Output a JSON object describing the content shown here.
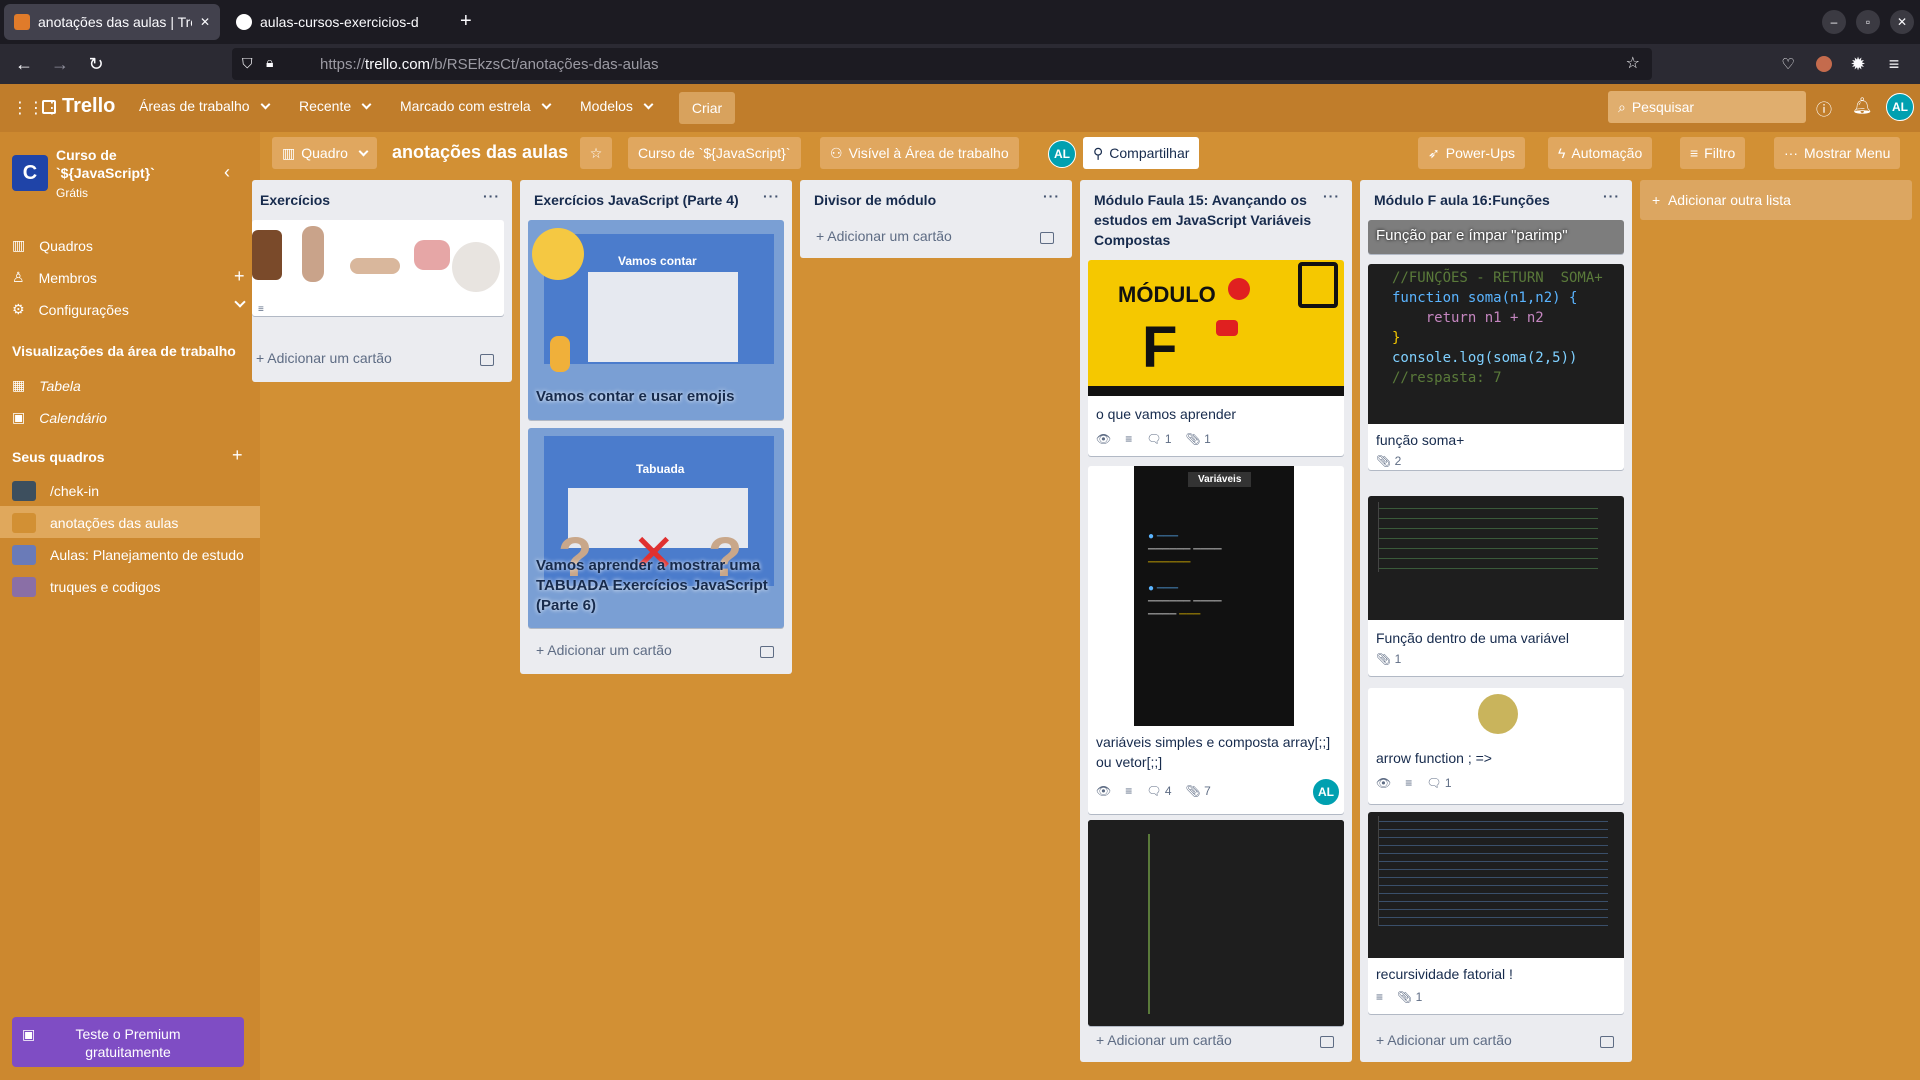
{
  "browser": {
    "tabs": [
      {
        "title": "anotações das aulas | Trel"
      },
      {
        "title": "aulas-cursos-exercicios-d"
      }
    ],
    "new_tab": "+",
    "url_prefix": "https://",
    "url_host": "trello.com",
    "url_path": "/b/RSEkzsCt/anotações-das-aulas",
    "win_min": "‒",
    "win_max": "▫",
    "win_close": "✕"
  },
  "header": {
    "logo": "Trello",
    "menus": [
      "Áreas de trabalho",
      "Recente",
      "Marcado com estrela",
      "Modelos"
    ],
    "create": "Criar",
    "search_placeholder": "Pesquisar",
    "user_initials": "AL"
  },
  "sidebar": {
    "ws_letter": "C",
    "ws_name": "Curso  de `${JavaScript}`",
    "ws_plan": "Grátis",
    "nav": [
      {
        "label": "Quadros"
      },
      {
        "label": "Membros"
      },
      {
        "label": "Configurações"
      }
    ],
    "views_title": "Visualizações da área de trabalho",
    "views": [
      "Tabela",
      "Calendário"
    ],
    "boards_title": "Seus quadros",
    "boards": [
      {
        "label": "/chek-in",
        "color": "#3d4f5e"
      },
      {
        "label": "anotações das aulas",
        "color": "#d29034"
      },
      {
        "label": "Aulas: Planejamento de estudo",
        "color": "#6a7bb8"
      },
      {
        "label": "truques e codigos",
        "color": "#8a6fa6"
      }
    ],
    "premium": "Teste o Premium gratuitamente"
  },
  "board": {
    "view": "Quadro",
    "title": "anotações das aulas",
    "workspace": "Curso de `${JavaScript}`",
    "visibility": "Visível à Área de trabalho",
    "share": "Compartilhar",
    "powerups": "Power-Ups",
    "automation": "Automação",
    "filter": "Filtro",
    "menu": "Mostrar Menu",
    "add_list": "Adicionar outra lista",
    "add_card": "Adicionar um cartão"
  },
  "lists": {
    "l1": {
      "title": "Exercícios"
    },
    "l2": {
      "title": "Exercícios JavaScript (Parte 4)",
      "c1": "Vamos contar e usar emojis",
      "c1_img": "Vamos contar",
      "c2": "Vamos aprender a mostrar uma TABUADA Exercícios JavaScript (Parte 6)",
      "c2_img": "Tabuada"
    },
    "l3": {
      "title": "Divisor de módulo"
    },
    "l4": {
      "title": "Módulo Faula 15: Avançando os estudos em JavaScript Variáveis Compostas",
      "c1": "o que vamos aprender",
      "c1_img": "MÓDULO",
      "c1_letter": "F",
      "c1_badges": [
        "1",
        "1"
      ],
      "c2": "variáveis simples e composta array[;;] ou vetor[;;]",
      "c2_img": "Variáveis",
      "c2_badges": [
        "4",
        "7"
      ],
      "c2_member": "AL"
    },
    "l5": {
      "title": "Módulo F aula 16:Funções",
      "c0": "Função par e ímpar \"parimp\"",
      "c1": "função soma+",
      "c1_badges": [
        "2"
      ],
      "c2": "Função dentro de uma variável",
      "c2_badges": [
        "1"
      ],
      "c3": "arrow function ; =>",
      "c3_badges": [
        "1"
      ],
      "c4": "recursividade fatorial !",
      "c4_badges": [
        "1"
      ],
      "code1": [
        "//FUNÇÕES - RETURN  SOMA+",
        "function soma(n1,n2) {",
        "    return n1 + n2",
        "}",
        "console.log(soma(2,5))",
        "//respasta: 7"
      ]
    }
  }
}
